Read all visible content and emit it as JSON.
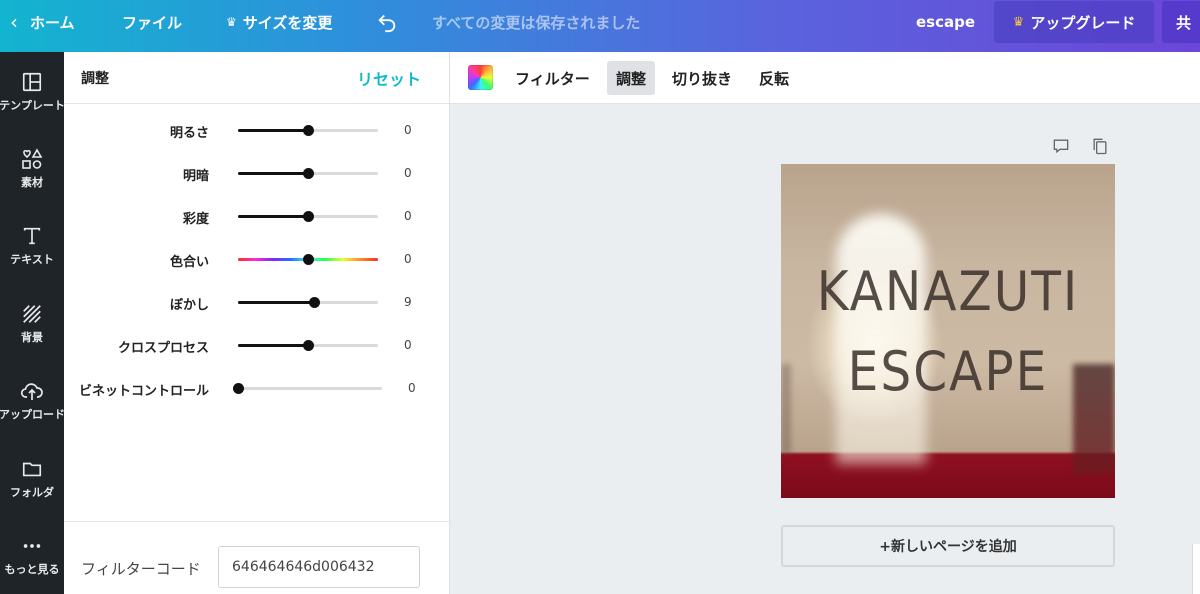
{
  "topbar": {
    "home": "ホーム",
    "file": "ファイル",
    "resize": "サイズを変更",
    "saved_status": "すべての変更は保存されました",
    "doc_title": "escape",
    "upgrade": "アップグレード",
    "share": "共"
  },
  "rail": {
    "items": [
      {
        "label": "テンプレート",
        "icon": "template-icon"
      },
      {
        "label": "素材",
        "icon": "shapes-icon"
      },
      {
        "label": "テキスト",
        "icon": "text-icon"
      },
      {
        "label": "背景",
        "icon": "background-icon"
      },
      {
        "label": "アップロード",
        "icon": "upload-icon"
      },
      {
        "label": "フォルダ",
        "icon": "folder-icon"
      },
      {
        "label": "もっと見る",
        "icon": "more-icon"
      }
    ]
  },
  "panel": {
    "title": "調整",
    "reset": "リセット",
    "sliders": [
      {
        "label": "明るさ",
        "value": "0",
        "level": 0.5
      },
      {
        "label": "明暗",
        "value": "0",
        "level": 0.5
      },
      {
        "label": "彩度",
        "value": "0",
        "level": 0.5
      },
      {
        "label": "色合い",
        "value": "0",
        "level": 0.5
      },
      {
        "label": "ぼかし",
        "value": "9",
        "level": 0.54
      },
      {
        "label": "クロスプロセス",
        "value": "0",
        "level": 0.5
      },
      {
        "label": "ビネットコントロール",
        "value": "0",
        "level": 0.0
      }
    ],
    "filter_code_label": "フィルターコード",
    "filter_code_value": "646464646d006432"
  },
  "toolbar": {
    "filter": "フィルター",
    "adjust": "調整",
    "crop": "切り抜き",
    "flip": "反転"
  },
  "canvas": {
    "line1": "KANAZUTI",
    "line2": "ESCAPE",
    "add_page": "+新しいページを追加"
  },
  "colors": {
    "reset_accent": "#14b8cc",
    "rail_bg": "#1f2428"
  }
}
